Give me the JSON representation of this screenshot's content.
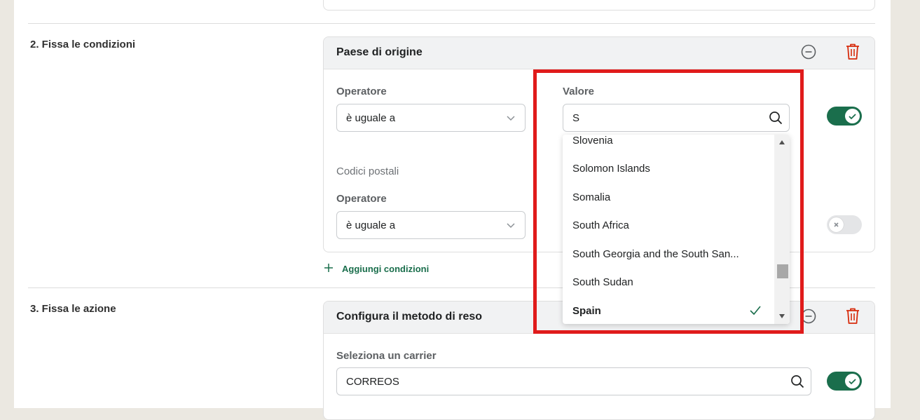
{
  "step2": {
    "title": "2. Fissa le condizioni",
    "card_title": "Paese di origine",
    "operator_label": "Operatore",
    "operator_value": "è uguale a",
    "value_label": "Valore",
    "search_value": "S",
    "postal_codes_label": "Codici postali",
    "operator2_label": "Operatore",
    "operator2_value": "è uguale a",
    "add_conditions": "Aggiungi condizioni"
  },
  "dropdown": {
    "options": [
      "Slovenia",
      "Solomon Islands",
      "Somalia",
      "South Africa",
      "South Georgia and the South San...",
      "South Sudan",
      "Spain"
    ],
    "selected": "Spain"
  },
  "step3": {
    "title": "3. Fissa le azione",
    "card_title": "Configura il metodo di reso",
    "carrier_label": "Seleziona un carrier",
    "carrier_value": "CORREOS"
  },
  "colors": {
    "accent": "#1a6e4c",
    "danger": "#d72c0d",
    "highlight": "#e01b1b"
  },
  "icons": [
    "minus-circle-icon",
    "trash-icon",
    "chevron-down-icon",
    "search-icon",
    "check-icon",
    "plus-icon"
  ]
}
